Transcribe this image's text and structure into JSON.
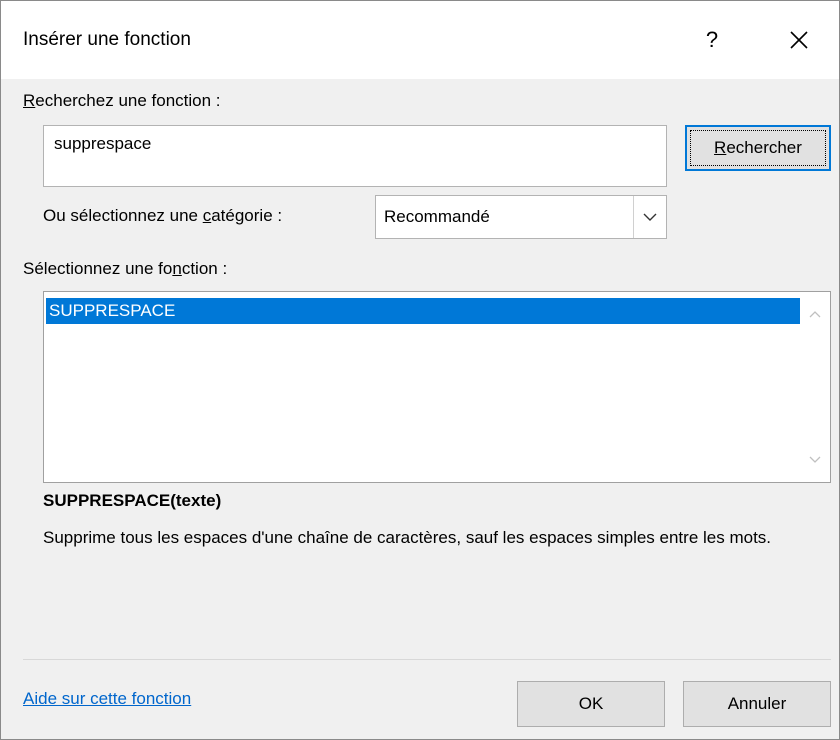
{
  "dialog": {
    "title": "Insérer une fonction",
    "help_glyph": "?",
    "close_glyph": "✕"
  },
  "search": {
    "label_before": "",
    "label_mnemonic": "R",
    "label_after": "echerchez une fonction :",
    "value": "supprespace",
    "button_before": "",
    "button_mnemonic": "R",
    "button_after": "echercher"
  },
  "category": {
    "label_before": "Ou sélectionnez une ",
    "label_mnemonic": "c",
    "label_after": "atégorie :",
    "selected": "Recommandé"
  },
  "function_list": {
    "label_before": "Sélectionnez une fo",
    "label_mnemonic": "n",
    "label_after": "ction :",
    "items": [
      "SUPPRESPACE"
    ]
  },
  "details": {
    "signature": "SUPPRESPACE(texte)",
    "description": "Supprime tous les espaces d'une chaîne de caractères, sauf les espaces simples entre les mots."
  },
  "footer": {
    "help_link": "Aide sur cette fonction",
    "ok_label": "OK",
    "cancel_label": "Annuler"
  },
  "colors": {
    "accent": "#0078d7",
    "link": "#0066cc"
  }
}
